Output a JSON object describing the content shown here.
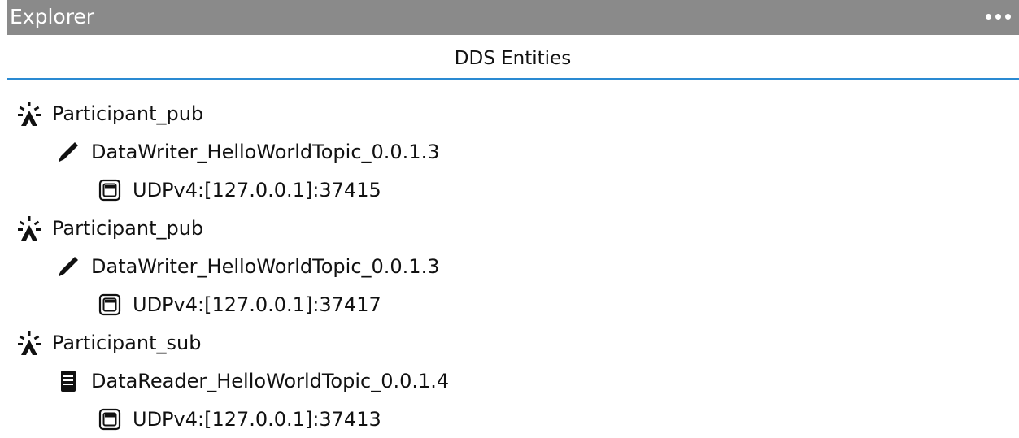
{
  "window": {
    "title": "Explorer",
    "menu_icon": "more-horizontal-icon"
  },
  "panel": {
    "title": "DDS Entities",
    "accent_color": "#2a8ad2"
  },
  "tree": [
    {
      "type": "participant",
      "icon": "participant-icon",
      "label": "Participant_pub",
      "children": [
        {
          "type": "datawriter",
          "icon": "pencil-icon",
          "label": "DataWriter_HelloWorldTopic_0.0.1.3",
          "children": [
            {
              "type": "locator",
              "icon": "network-port-icon",
              "label": "UDPv4:[127.0.0.1]:37415"
            }
          ]
        }
      ]
    },
    {
      "type": "participant",
      "icon": "participant-icon",
      "label": "Participant_pub",
      "children": [
        {
          "type": "datawriter",
          "icon": "pencil-icon",
          "label": "DataWriter_HelloWorldTopic_0.0.1.3",
          "children": [
            {
              "type": "locator",
              "icon": "network-port-icon",
              "label": "UDPv4:[127.0.0.1]:37417"
            }
          ]
        }
      ]
    },
    {
      "type": "participant",
      "icon": "participant-icon",
      "label": "Participant_sub",
      "children": [
        {
          "type": "datareader",
          "icon": "document-icon",
          "label": "DataReader_HelloWorldTopic_0.0.1.4",
          "children": [
            {
              "type": "locator",
              "icon": "network-port-icon",
              "label": "UDPv4:[127.0.0.1]:37413"
            }
          ]
        }
      ]
    }
  ]
}
